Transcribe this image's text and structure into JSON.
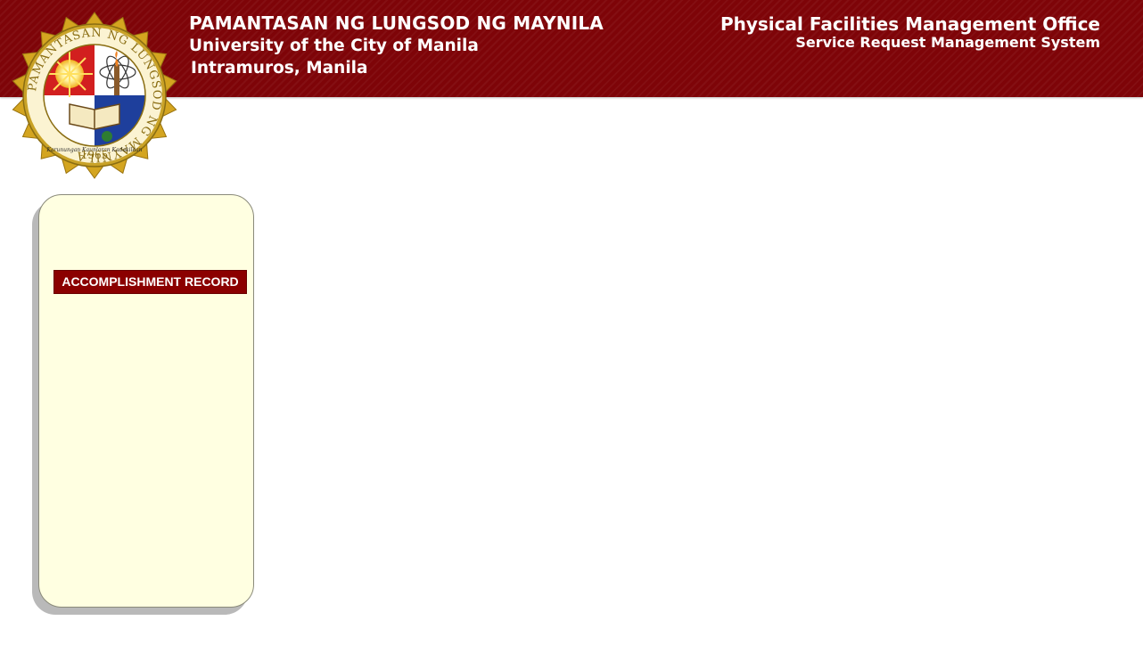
{
  "header": {
    "university_name": "PAMANTASAN NG LUNGSOD NG MAYNILA",
    "university_english": "University of the City of Manila",
    "location": "Intramuros, Manila",
    "office_name": "Physical Facilities Management Office",
    "system_name": "Service Request Management System"
  },
  "seal": {
    "ring_text": "PAMANTASAN NG LUNGSOD NG MAYNILA",
    "motto": "Karunungan Kaunlaran Kadakilaan",
    "year": "1965"
  },
  "sidebar": {
    "items": [
      {
        "label": "ACCOMPLISHMENT RECORD"
      }
    ]
  },
  "colors": {
    "header_bg": "#7e0408",
    "panel_bg": "#ffffe1",
    "button_bg": "#8b0000",
    "seal_gold": "#c9a227"
  }
}
